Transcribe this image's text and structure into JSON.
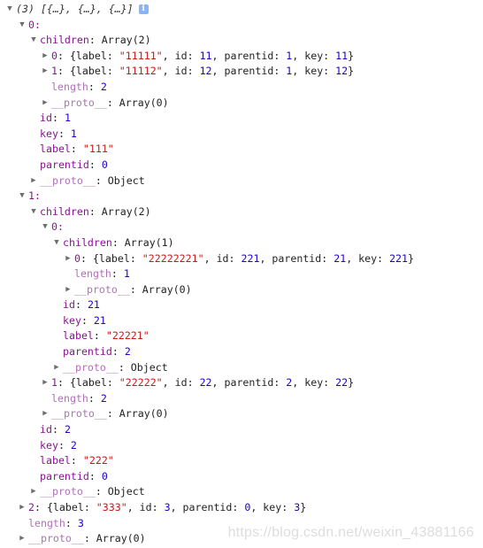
{
  "console": {
    "header_count": "(3)",
    "header_preview": "[{…}, {…}, {…}]",
    "info_glyph": "i"
  },
  "tree": [
    {
      "indent": 0,
      "tri": "open",
      "parts": [
        [
          "key",
          "0:"
        ]
      ]
    },
    {
      "indent": 1,
      "tri": "open",
      "parts": [
        [
          "key",
          "children"
        ],
        [
          "p",
          ": Array(2)"
        ]
      ]
    },
    {
      "indent": 2,
      "tri": "closed",
      "parts": [
        [
          "key",
          "0"
        ],
        [
          "p",
          ": {label: "
        ],
        [
          "str",
          "\"11111\""
        ],
        [
          "p",
          ", id: "
        ],
        [
          "num",
          "11"
        ],
        [
          "p",
          ", parentid: "
        ],
        [
          "num",
          "1"
        ],
        [
          "p",
          ", key: "
        ],
        [
          "num",
          "11"
        ],
        [
          "p",
          "}"
        ]
      ]
    },
    {
      "indent": 2,
      "tri": "closed",
      "parts": [
        [
          "key",
          "1"
        ],
        [
          "p",
          ": {label: "
        ],
        [
          "str",
          "\"11112\""
        ],
        [
          "p",
          ", id: "
        ],
        [
          "num",
          "12"
        ],
        [
          "p",
          ", parentid: "
        ],
        [
          "num",
          "1"
        ],
        [
          "p",
          ", key: "
        ],
        [
          "num",
          "12"
        ],
        [
          "p",
          "}"
        ]
      ]
    },
    {
      "indent": 2,
      "tri": "none",
      "parts": [
        [
          "len",
          "length"
        ],
        [
          "p",
          ": "
        ],
        [
          "num",
          "2"
        ]
      ]
    },
    {
      "indent": 2,
      "tri": "closed",
      "parts": [
        [
          "proto",
          "__proto__"
        ],
        [
          "p",
          ": Array(0)"
        ]
      ]
    },
    {
      "indent": 1,
      "tri": "none",
      "parts": [
        [
          "key",
          "id"
        ],
        [
          "p",
          ": "
        ],
        [
          "num",
          "1"
        ]
      ]
    },
    {
      "indent": 1,
      "tri": "none",
      "parts": [
        [
          "key",
          "key"
        ],
        [
          "p",
          ": "
        ],
        [
          "num",
          "1"
        ]
      ]
    },
    {
      "indent": 1,
      "tri": "none",
      "parts": [
        [
          "key",
          "label"
        ],
        [
          "p",
          ": "
        ],
        [
          "str",
          "\"111\""
        ]
      ]
    },
    {
      "indent": 1,
      "tri": "none",
      "parts": [
        [
          "key",
          "parentid"
        ],
        [
          "p",
          ": "
        ],
        [
          "num",
          "0"
        ]
      ]
    },
    {
      "indent": 1,
      "tri": "closed",
      "parts": [
        [
          "proto",
          "__proto__"
        ],
        [
          "p",
          ": Object"
        ]
      ]
    },
    {
      "indent": 0,
      "tri": "open",
      "parts": [
        [
          "key",
          "1:"
        ]
      ]
    },
    {
      "indent": 1,
      "tri": "open",
      "parts": [
        [
          "key",
          "children"
        ],
        [
          "p",
          ": Array(2)"
        ]
      ]
    },
    {
      "indent": 2,
      "tri": "open",
      "parts": [
        [
          "key",
          "0:"
        ]
      ]
    },
    {
      "indent": 3,
      "tri": "open",
      "parts": [
        [
          "key",
          "children"
        ],
        [
          "p",
          ": Array(1)"
        ]
      ]
    },
    {
      "indent": 4,
      "tri": "closed",
      "parts": [
        [
          "key",
          "0"
        ],
        [
          "p",
          ": {label: "
        ],
        [
          "str",
          "\"22222221\""
        ],
        [
          "p",
          ", id: "
        ],
        [
          "num",
          "221"
        ],
        [
          "p",
          ", parentid: "
        ],
        [
          "num",
          "21"
        ],
        [
          "p",
          ", key: "
        ],
        [
          "num",
          "221"
        ],
        [
          "p",
          "}"
        ]
      ]
    },
    {
      "indent": 4,
      "tri": "none",
      "parts": [
        [
          "len",
          "length"
        ],
        [
          "p",
          ": "
        ],
        [
          "num",
          "1"
        ]
      ]
    },
    {
      "indent": 4,
      "tri": "closed",
      "parts": [
        [
          "proto",
          "__proto__"
        ],
        [
          "p",
          ": Array(0)"
        ]
      ]
    },
    {
      "indent": 3,
      "tri": "none",
      "parts": [
        [
          "key",
          "id"
        ],
        [
          "p",
          ": "
        ],
        [
          "num",
          "21"
        ]
      ]
    },
    {
      "indent": 3,
      "tri": "none",
      "parts": [
        [
          "key",
          "key"
        ],
        [
          "p",
          ": "
        ],
        [
          "num",
          "21"
        ]
      ]
    },
    {
      "indent": 3,
      "tri": "none",
      "parts": [
        [
          "key",
          "label"
        ],
        [
          "p",
          ": "
        ],
        [
          "str",
          "\"22221\""
        ]
      ]
    },
    {
      "indent": 3,
      "tri": "none",
      "parts": [
        [
          "key",
          "parentid"
        ],
        [
          "p",
          ": "
        ],
        [
          "num",
          "2"
        ]
      ]
    },
    {
      "indent": 3,
      "tri": "closed",
      "parts": [
        [
          "proto",
          "__proto__"
        ],
        [
          "p",
          ": Object"
        ]
      ]
    },
    {
      "indent": 2,
      "tri": "closed",
      "parts": [
        [
          "key",
          "1"
        ],
        [
          "p",
          ": {label: "
        ],
        [
          "str",
          "\"22222\""
        ],
        [
          "p",
          ", id: "
        ],
        [
          "num",
          "22"
        ],
        [
          "p",
          ", parentid: "
        ],
        [
          "num",
          "2"
        ],
        [
          "p",
          ", key: "
        ],
        [
          "num",
          "22"
        ],
        [
          "p",
          "}"
        ]
      ]
    },
    {
      "indent": 2,
      "tri": "none",
      "parts": [
        [
          "len",
          "length"
        ],
        [
          "p",
          ": "
        ],
        [
          "num",
          "2"
        ]
      ]
    },
    {
      "indent": 2,
      "tri": "closed",
      "parts": [
        [
          "proto",
          "__proto__"
        ],
        [
          "p",
          ": Array(0)"
        ]
      ]
    },
    {
      "indent": 1,
      "tri": "none",
      "parts": [
        [
          "key",
          "id"
        ],
        [
          "p",
          ": "
        ],
        [
          "num",
          "2"
        ]
      ]
    },
    {
      "indent": 1,
      "tri": "none",
      "parts": [
        [
          "key",
          "key"
        ],
        [
          "p",
          ": "
        ],
        [
          "num",
          "2"
        ]
      ]
    },
    {
      "indent": 1,
      "tri": "none",
      "parts": [
        [
          "key",
          "label"
        ],
        [
          "p",
          ": "
        ],
        [
          "str",
          "\"222\""
        ]
      ]
    },
    {
      "indent": 1,
      "tri": "none",
      "parts": [
        [
          "key",
          "parentid"
        ],
        [
          "p",
          ": "
        ],
        [
          "num",
          "0"
        ]
      ]
    },
    {
      "indent": 1,
      "tri": "closed",
      "parts": [
        [
          "proto",
          "__proto__"
        ],
        [
          "p",
          ": Object"
        ]
      ]
    },
    {
      "indent": 0,
      "tri": "closed",
      "parts": [
        [
          "key",
          "2"
        ],
        [
          "p",
          ": {label: "
        ],
        [
          "str",
          "\"333\""
        ],
        [
          "p",
          ", id: "
        ],
        [
          "num",
          "3"
        ],
        [
          "p",
          ", parentid: "
        ],
        [
          "num",
          "0"
        ],
        [
          "p",
          ", key: "
        ],
        [
          "num",
          "3"
        ],
        [
          "p",
          "}"
        ]
      ]
    },
    {
      "indent": 0,
      "tri": "none",
      "parts": [
        [
          "len",
          "length"
        ],
        [
          "p",
          ": "
        ],
        [
          "num",
          "3"
        ]
      ]
    },
    {
      "indent": 0,
      "tri": "closed",
      "parts": [
        [
          "proto",
          "__proto__"
        ],
        [
          "p",
          ": Array(0)"
        ]
      ]
    }
  ],
  "watermark": "https://blog.csdn.net/weixin_43881166"
}
